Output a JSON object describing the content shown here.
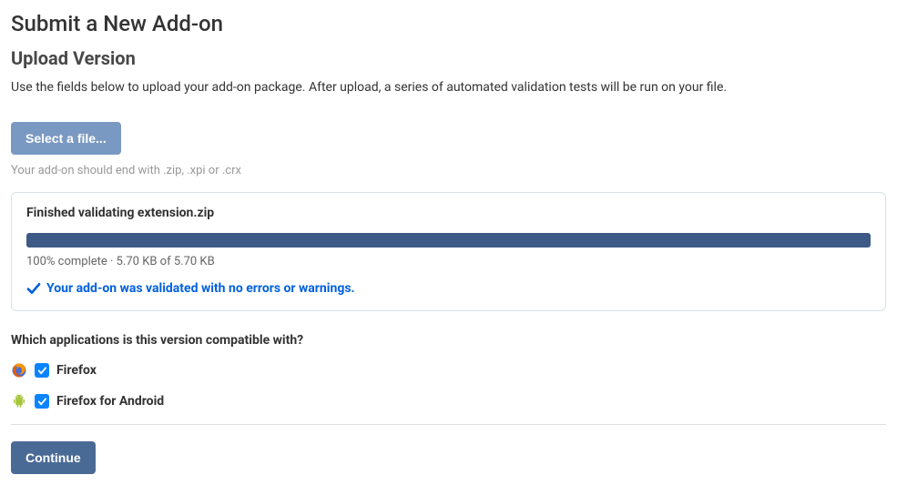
{
  "page_title": "Submit a New Add-on",
  "section_title": "Upload Version",
  "description": "Use the fields below to upload your add-on package. After upload, a series of automated validation tests will be run on your file.",
  "select_file_button": "Select a file...",
  "file_hint": "Your add-on should end with .zip, .xpi or .crx",
  "validation": {
    "title": "Finished validating extension.zip",
    "progress_text": "100% complete · 5.70 KB of 5.70 KB",
    "result_text": "Your add-on was validated with no errors or warnings."
  },
  "compatibility": {
    "title": "Which applications is this version compatible with?",
    "apps": [
      {
        "id": "firefox",
        "label": "Firefox",
        "checked": true
      },
      {
        "id": "firefox-android",
        "label": "Firefox for Android",
        "checked": true
      }
    ]
  },
  "continue_button": "Continue"
}
